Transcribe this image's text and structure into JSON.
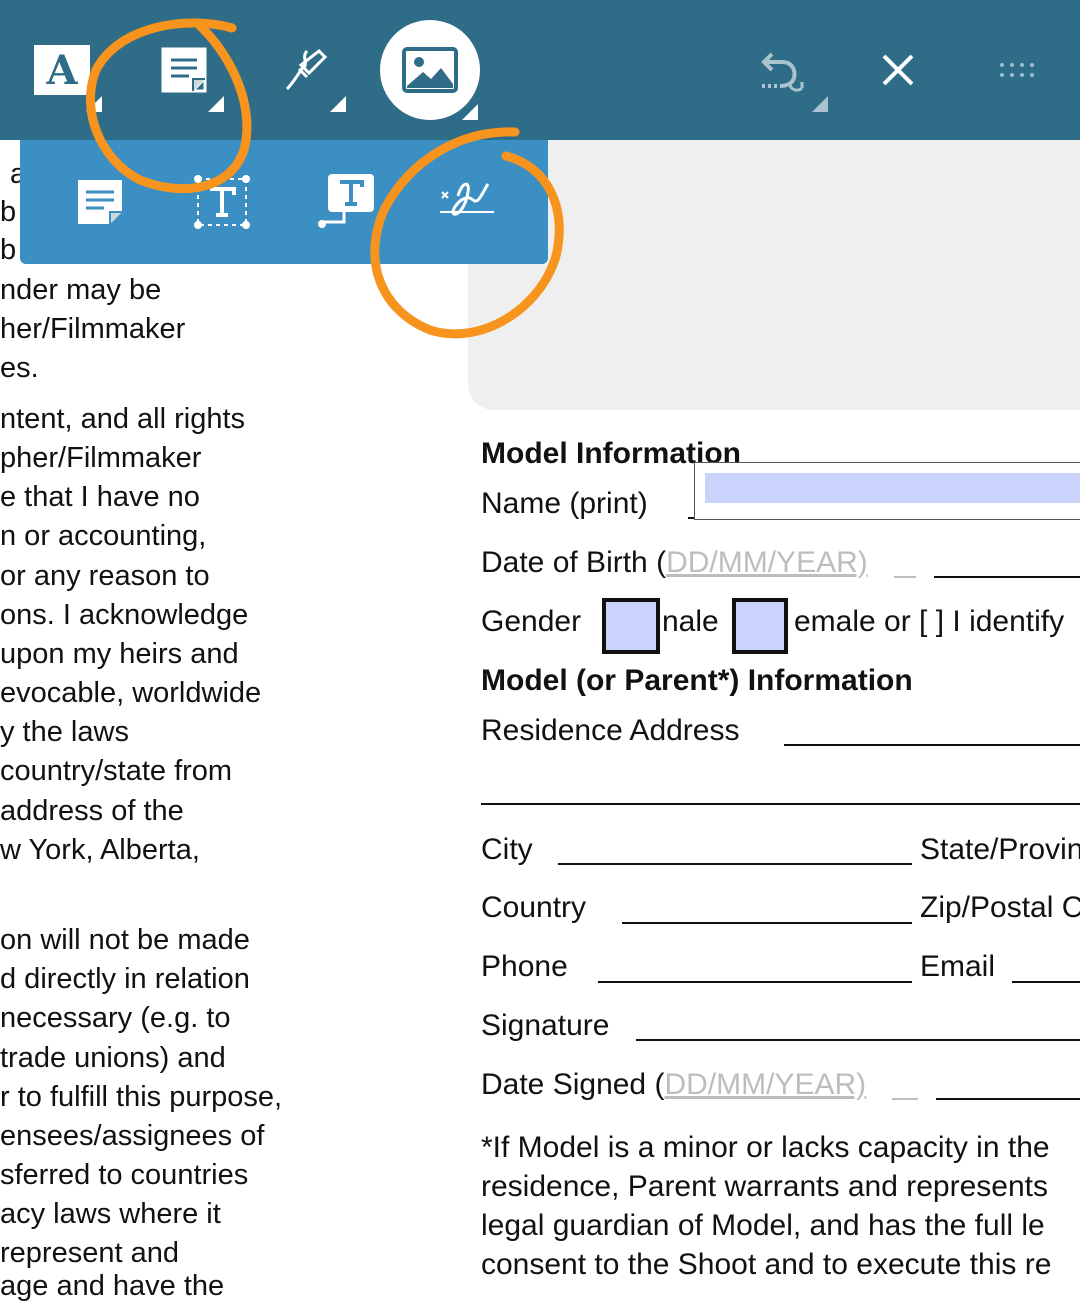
{
  "toolbar": {
    "tools": [
      {
        "icon": "text-format-icon",
        "label": "A"
      },
      {
        "icon": "note-icon"
      },
      {
        "icon": "pen-icon"
      },
      {
        "icon": "image-icon"
      }
    ],
    "right": [
      {
        "icon": "undo-icon"
      },
      {
        "icon": "close-icon"
      },
      {
        "icon": "drag-handle-icon"
      }
    ],
    "accent": "#2f6c87",
    "submenu_color": "#3b8fc2"
  },
  "submenu": {
    "items": [
      {
        "icon": "sticky-note-icon"
      },
      {
        "icon": "text-box-icon"
      },
      {
        "icon": "text-callout-icon"
      },
      {
        "icon": "signature-icon"
      }
    ]
  },
  "left_text": [
    "a",
    "b",
    "b",
    "nder may be",
    "her/Filmmaker",
    "es.",
    "ntent, and all rights",
    "pher/Filmmaker",
    "e that I have no",
    "n or accounting,",
    "or any reason to",
    "ons. I acknowledge",
    "upon my heirs and",
    "evocable, worldwide",
    "y the laws",
    "country/state from",
    "address of the",
    "w York, Alberta,",
    "on will not be made",
    "d directly in relation",
    "necessary (e.g. to",
    "trade unions) and",
    "r to fulfill this purpose,",
    "ensees/assignees of",
    "sferred to countries",
    "acy laws where it",
    "represent and",
    "age and have the"
  ],
  "form": {
    "model_info_heading": "Model Information",
    "name_label": "Name (print)",
    "dob_label": "Date of Birth (",
    "dob_placeholder": "DD/MM/YEAR)",
    "gender_label": "Gender",
    "male_text": "nale",
    "female_text": "emale or [  ] I identify",
    "parent_heading": "Model (or Parent*) Information",
    "residence_label": "Residence Address",
    "city_label": "City",
    "state_label": "State/Provin",
    "country_label": "Country",
    "zip_label": "Zip/Postal C",
    "phone_label": "Phone",
    "email_label": "Email",
    "signature_label": "Signature",
    "date_signed_label": "Date Signed (",
    "date_signed_placeholder": "DD/MM/YEAR)",
    "footnote": [
      "*If Model is a minor or lacks capacity in the",
      "residence, Parent warrants and represents",
      "legal guardian of Model, and has the full le",
      "consent to the Shoot and to execute this re"
    ]
  },
  "annotation_color": "#f7941d"
}
